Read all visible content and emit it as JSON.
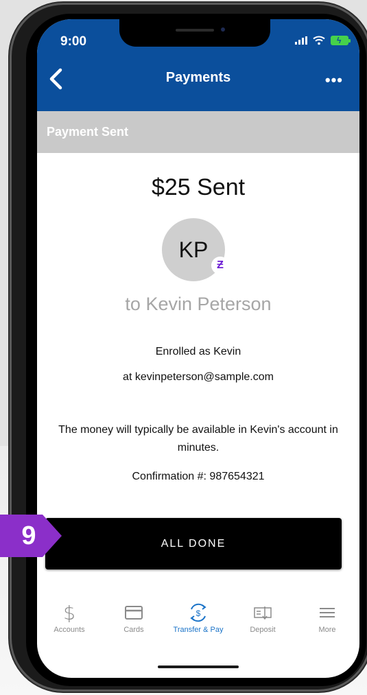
{
  "status_bar": {
    "time": "9:00"
  },
  "nav": {
    "title": "Payments",
    "back_icon": "chevron-left-icon",
    "more_label": "•••"
  },
  "section": {
    "label": "Payment Sent"
  },
  "payment": {
    "amount_text": "$25 Sent",
    "avatar_initials": "KP",
    "zelle_badge": "Ƶ",
    "recipient_text": "to Kevin Peterson",
    "enrolled_text": "Enrolled as Kevin",
    "email_text": "at kevinpeterson@sample.com",
    "availability_message": "The money will typically be available in Kevin's account in minutes.",
    "confirmation_text": "Confirmation #: 987654321"
  },
  "actions": {
    "done_label": "ALL DONE"
  },
  "tabbar": {
    "items": [
      {
        "label": "Accounts",
        "icon": "dollar-icon",
        "active": false
      },
      {
        "label": "Cards",
        "icon": "card-icon",
        "active": false
      },
      {
        "label": "Transfer & Pay",
        "icon": "transfer-pay-icon",
        "active": true
      },
      {
        "label": "Deposit",
        "icon": "check-deposit-icon",
        "active": false
      },
      {
        "label": "More",
        "icon": "menu-icon",
        "active": false
      }
    ]
  },
  "callout": {
    "step_number": "9"
  },
  "colors": {
    "header_blue": "#0b4f9c",
    "section_gray": "#c9c9c9",
    "callout_purple": "#8b2fc9",
    "active_tab": "#1a73c8",
    "button_black": "#000000"
  }
}
